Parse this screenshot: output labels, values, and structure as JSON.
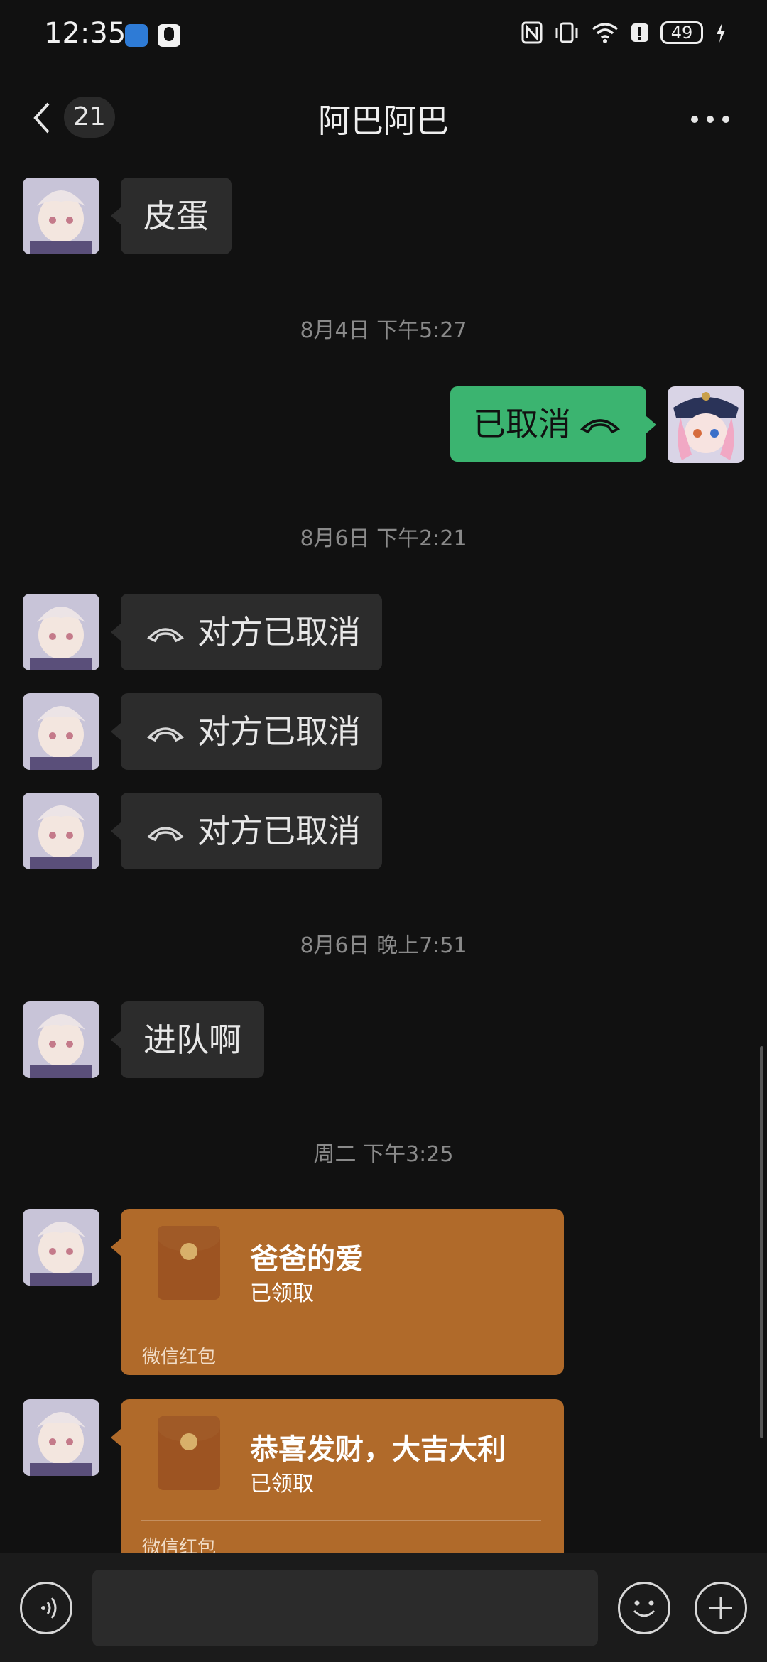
{
  "status_bar": {
    "time": "12:35",
    "battery": "49",
    "icons": [
      "nfc-icon",
      "vibrate-icon",
      "wifi-icon",
      "alert-icon",
      "battery-icon",
      "charging-icon"
    ]
  },
  "header": {
    "back_count": "21",
    "title": "阿巴阿巴",
    "more_icon": "more-icon"
  },
  "messages": {
    "m1": "皮蛋",
    "ts1": "8月4日 下午5:27",
    "m2": "已取消",
    "ts2": "8月6日 下午2:21",
    "m3": "对方已取消",
    "m4": "对方已取消",
    "m5": "对方已取消",
    "ts3": "8月6日 晚上7:51",
    "m6": "进队啊",
    "ts4": "周二 下午3:25"
  },
  "red_packets": [
    {
      "title": "爸爸的爱",
      "status": "已领取",
      "footer": "微信红包"
    },
    {
      "title": "恭喜发财，大吉大利",
      "status": "已领取",
      "footer": "微信红包"
    }
  ],
  "colors": {
    "background": "#111111",
    "incoming_bubble": "#2c2c2c",
    "outgoing_bubble": "#3bb470",
    "red_packet": "#b06a2a"
  }
}
